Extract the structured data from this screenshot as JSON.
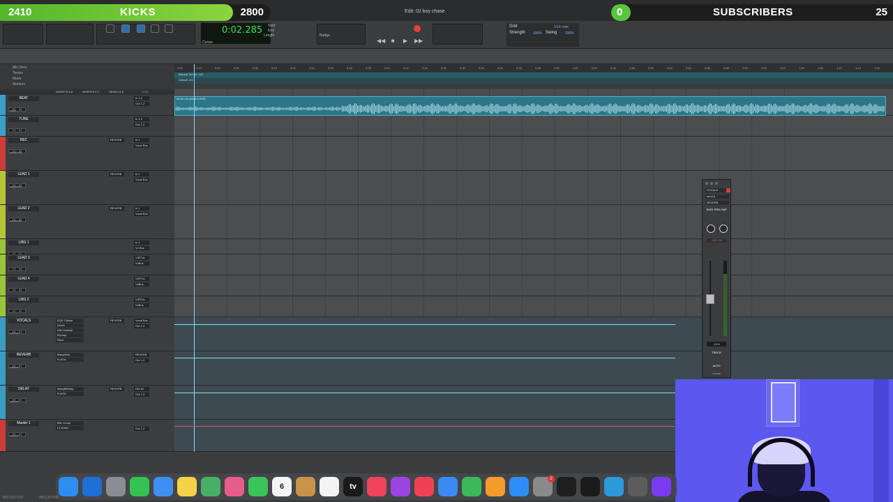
{
  "overlay": {
    "kicks": {
      "left_value": "2410",
      "title": "KICKS",
      "right_value": "2800",
      "progress": 0.86
    },
    "subscribers": {
      "left_value": "0",
      "title": "SUBSCRIBERS",
      "right_value": "25",
      "progress": 0.0
    }
  },
  "window": {
    "title": "Edit: 02 boy chase"
  },
  "counter": {
    "main": "0:02.285",
    "start_label": "Start",
    "end_label": "End",
    "length_label": "Length",
    "cursor_label": "Cursor",
    "nudge_label": "Nudge"
  },
  "grid": {
    "label": "Grid",
    "value": "1/16 note",
    "nudge": "Nudge",
    "strength": "Strength",
    "strength_val": "100%",
    "swing": "Swing",
    "swing_val": "100%"
  },
  "ruler": {
    "labels": [
      "Min:Secs",
      "Tempo",
      "Meter",
      "Markers"
    ],
    "ticks": [
      "0:00",
      "0:02",
      "0:04",
      "0:06",
      "0:08",
      "0:10",
      "0:12",
      "0:14",
      "0:16",
      "0:18",
      "0:20",
      "0:22",
      "0:24",
      "0:26",
      "0:28",
      "0:30",
      "0:32",
      "0:34",
      "0:36",
      "0:38",
      "0:40",
      "0:42",
      "0:44",
      "0:46",
      "0:48",
      "0:50",
      "0:52",
      "0:54",
      "0:56",
      "0:58",
      "1:00",
      "1:02",
      "1:04",
      "1:06",
      "1:08",
      "1:10",
      "1:12",
      "1:14"
    ],
    "tempo_text": "Manual Tempo: 118",
    "meter_text": "Default: 4/4"
  },
  "columns": {
    "inserts_ae": "INSERTS A-E",
    "inserts_fj": "INSERTS F-J",
    "sends_ae": "SENDS A-E",
    "io": "I / O"
  },
  "tracks": [
    {
      "name": "BEAT",
      "color": "#3aa0c9",
      "send": "",
      "io_in": "in 1-2",
      "io_out": "Out 1-2",
      "mode": "wave"
    },
    {
      "name": "TUNE",
      "color": "#3aa0c9",
      "send": "",
      "io_in": "in 1-2",
      "io_out": "Out 1-2",
      "mode": ""
    },
    {
      "name": "REC",
      "color": "#cf3b3b",
      "send": "REVERB",
      "io_in": "In 1",
      "io_out": "Vocal Bus",
      "mode": "waveform"
    },
    {
      "name": "LEAD 1",
      "color": "#b7c437",
      "send": "REVERB",
      "io_in": "In 1",
      "io_out": "Vocal Bus",
      "mode": "waveform"
    },
    {
      "name": "LEAD 2",
      "color": "#b7c437",
      "send": "REVERB",
      "io_in": "In 1",
      "io_out": "Vocal Bus",
      "mode": "waveform"
    },
    {
      "name": "LIBS 1",
      "color": "#9ac43a",
      "send": "",
      "io_in": "In 1",
      "io_out": "Vo Bus",
      "mode": ""
    },
    {
      "name": "LEAD 3",
      "color": "#9ac43a",
      "send": "",
      "io_in": "VIRTUL",
      "io_out": "VoBus",
      "mode": ""
    },
    {
      "name": "LEAD 4",
      "color": "#9ac43a",
      "send": "",
      "io_in": "VIRTUL",
      "io_out": "VoBus",
      "mode": ""
    },
    {
      "name": "LIBS 2",
      "color": "#9ac43a",
      "send": "",
      "io_in": "VIRTUL",
      "io_out": "VoBus",
      "mode": ""
    },
    {
      "name": "VOCALS",
      "color": "#3a9cc4",
      "send": "REVERB",
      "io_in": "Vocal Bus",
      "io_out": "Out 1-2",
      "mode": "volume",
      "inserts": [
        "EQ3 7-Band",
        "Dverb",
        "D3LChannel",
        "BComp",
        "Rbox"
      ]
    },
    {
      "name": "REVERB",
      "color": "#3a9cc4",
      "send": "",
      "io_in": "REVERB",
      "io_out": "Out 1-2",
      "mode": "volume",
      "inserts": [
        "ManyVerb",
        "Fl-NTA"
      ]
    },
    {
      "name": "DELAY",
      "color": "#3a9cc4",
      "send": "REVERB",
      "io_in": "DELAY",
      "io_out": "Out 1-2",
      "mode": "volume",
      "inserts": [
        "ManyMDelay",
        "Fl-NTA"
      ]
    },
    {
      "name": "Master 1",
      "color": "#cf3b3b",
      "send": "",
      "io_in": "",
      "io_out": "Out 1-2",
      "mode": "volume",
      "inserts": [
        "BSL Comp",
        "L1 limiter"
      ]
    }
  ],
  "clip": {
    "name": "do for me words 1.0001"
  },
  "mixer": {
    "track_name": "VOCALS",
    "slots": [
      "send A",
      "REVERB"
    ],
    "buttons": "SAFE  PRE  FMP",
    "pan_value": "-100   100",
    "readout": "-12.6",
    "track_label": "TRACK",
    "auto_label": "AUTO",
    "bottom": "Vocals"
  },
  "dock": {
    "icons": [
      "Finder",
      "Safari",
      "Launchpad",
      "Messages",
      "Mail",
      "Notes",
      "Maps",
      "Photos",
      "FaceTime",
      "Calendar",
      "Contacts",
      "Reminders",
      "TV",
      "Music",
      "Podcasts",
      "News",
      "Keynote",
      "Numbers",
      "Pages",
      "App Store",
      "Settings",
      "Guitar",
      "iLok",
      "Waves",
      "Utility",
      "Pro Tools"
    ],
    "calendar_day": "6",
    "calendar_month": "MAY",
    "tv_label": "tv",
    "settings_badge": "2"
  },
  "bottom_labels": {
    "left": "MIX EDITOR",
    "right": "MELODYNE"
  }
}
